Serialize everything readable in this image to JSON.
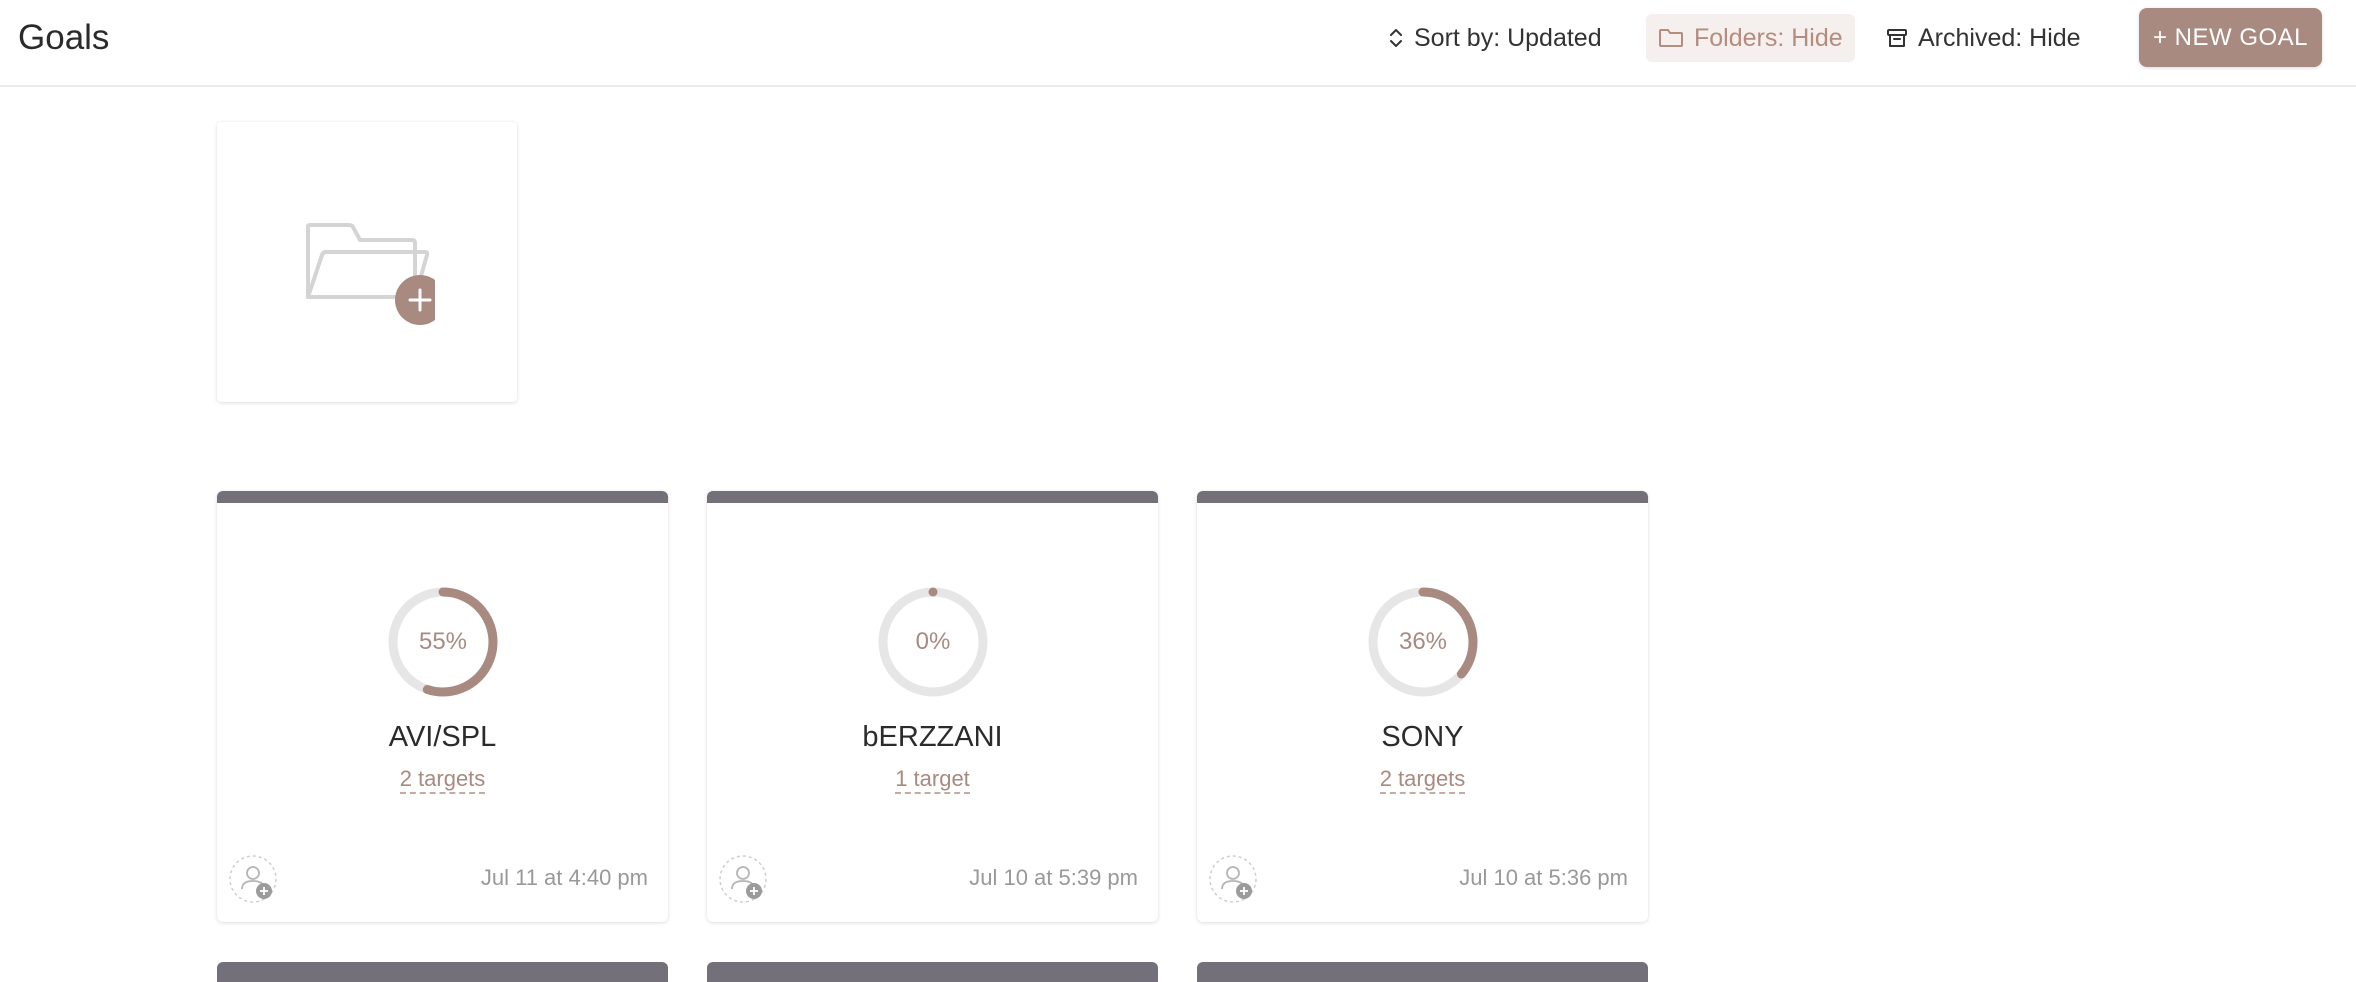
{
  "header": {
    "title": "Goals",
    "sort_label": "Sort by: Updated",
    "folders_label": "Folders: Hide",
    "archived_label": "Archived: Hide",
    "new_goal_label": "+ NEW GOAL"
  },
  "colors": {
    "accent": "#a98a80",
    "card_topbar": "#737079",
    "ring_track": "#e6e6e6"
  },
  "goals": [
    {
      "name": "AVI/SPL",
      "progress": 55,
      "progress_label": "55%",
      "targets": "2 targets",
      "updated": "Jul 11 at 4:40 pm"
    },
    {
      "name": "bERZZANI",
      "progress": 0,
      "progress_label": "0%",
      "targets": "1 target",
      "updated": "Jul 10 at 5:39 pm"
    },
    {
      "name": "SONY",
      "progress": 36,
      "progress_label": "36%",
      "targets": "2 targets",
      "updated": "Jul 10 at 5:36 pm"
    }
  ]
}
